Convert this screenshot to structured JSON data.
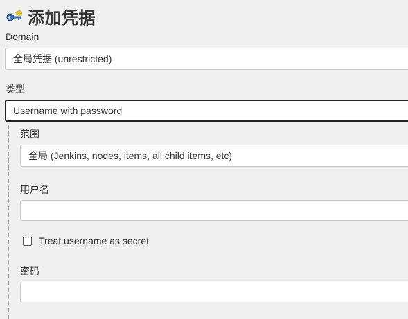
{
  "header": {
    "title": "添加凭据",
    "icon": "key-icon"
  },
  "domain": {
    "label": "Domain",
    "value": "全局凭据 (unrestricted)"
  },
  "kind": {
    "label": "类型",
    "value": "Username with password"
  },
  "scope": {
    "label": "范围",
    "value": "全局 (Jenkins, nodes, items, all child items, etc)"
  },
  "username": {
    "label": "用户名",
    "value": ""
  },
  "treat_secret": {
    "label": "Treat username as secret",
    "checked": false
  },
  "password": {
    "label": "密码",
    "value": ""
  },
  "colors": {
    "background": "#f0f0f0",
    "key_blue": "#3a6fb3",
    "key_yellow": "#f2c230"
  }
}
